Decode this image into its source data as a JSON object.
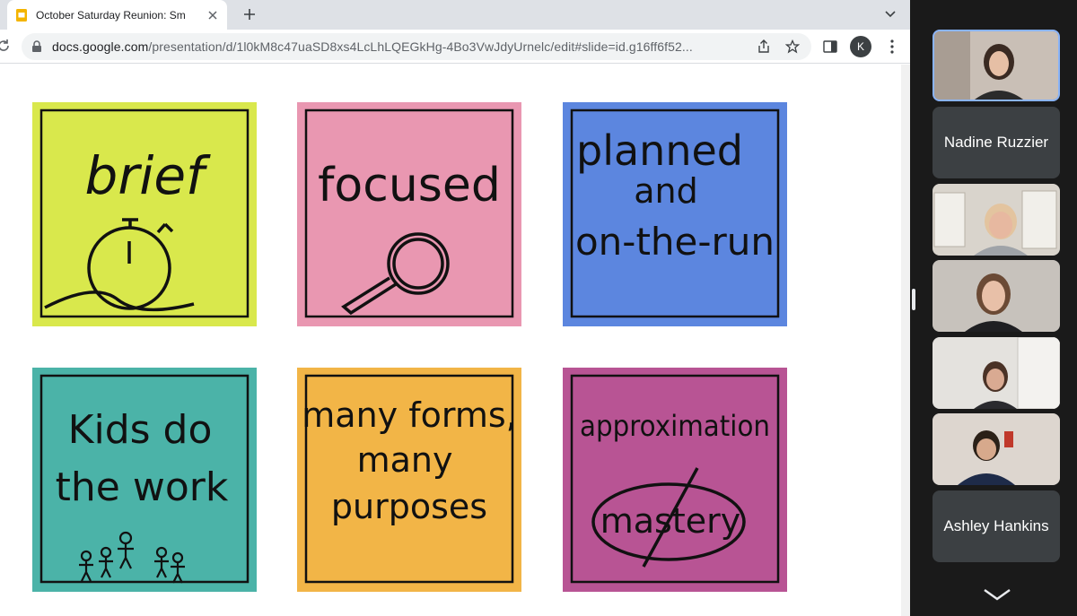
{
  "browser": {
    "tab_title": "October Saturday Reunion: Sm",
    "url_host": "docs.google.com",
    "url_path": "/presentation/d/1l0kM8c47uaSD8xs4LcLhLQEGkHg-4Bo3VwJdyUrnelc/edit#slide=id.g16ff6f52...",
    "profile_initial": "K"
  },
  "slide": {
    "notes": [
      {
        "id": "brief",
        "color": "#d9e84c",
        "lines": [
          "brief"
        ]
      },
      {
        "id": "focused",
        "color": "#e997b1",
        "lines": [
          "focused"
        ]
      },
      {
        "id": "planned",
        "color": "#5c86df",
        "lines": [
          "planned",
          "and",
          "on-the-run"
        ]
      },
      {
        "id": "kids",
        "color": "#4bb3a8",
        "lines": [
          "Kids do",
          "the work"
        ]
      },
      {
        "id": "forms",
        "color": "#f2b547",
        "lines": [
          "many forms,",
          "many",
          "purposes"
        ]
      },
      {
        "id": "approx",
        "color": "#b85494",
        "lines": [
          "approximation",
          "mastery"
        ]
      }
    ]
  },
  "meet": {
    "participants": [
      {
        "name": "",
        "type": "video-active"
      },
      {
        "name": "Nadine Ruzzier",
        "type": "name"
      },
      {
        "name": "",
        "type": "video"
      },
      {
        "name": "",
        "type": "video"
      },
      {
        "name": "",
        "type": "video"
      },
      {
        "name": "",
        "type": "video"
      },
      {
        "name": "Ashley Hankins",
        "type": "name"
      }
    ]
  }
}
